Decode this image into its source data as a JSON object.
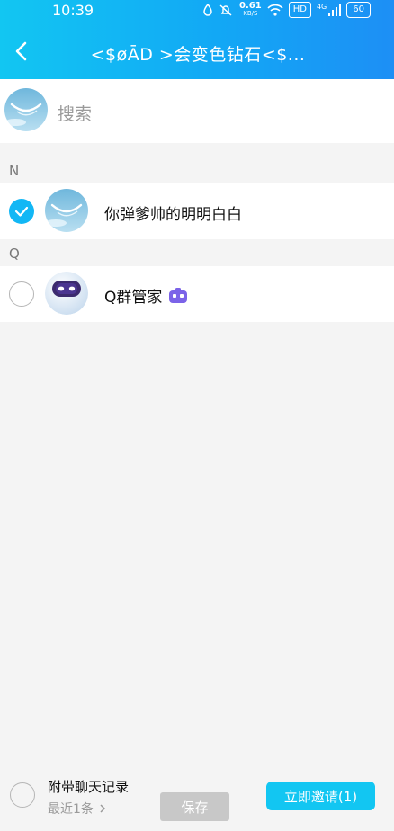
{
  "status_bar": {
    "time": "10:39",
    "speed_value": "0.61",
    "speed_unit": "KB/S",
    "hd_badge": "HD",
    "network": "4G",
    "battery": "60"
  },
  "header": {
    "title": "<$øĀD >会变色钻石<$...",
    "back_icon": "chevron-left-icon"
  },
  "search": {
    "placeholder": "搜索"
  },
  "sections": [
    {
      "letter": "N",
      "contacts": [
        {
          "name": "你弹爹帅的明明白白",
          "selected": true
        }
      ]
    },
    {
      "letter": "Q",
      "contacts": [
        {
          "name": "Q群管家",
          "selected": false,
          "badge_icon": "robot-badge-icon"
        }
      ]
    }
  ],
  "bottom": {
    "attach_label": "附带聊天记录",
    "attach_sub": "最近1条",
    "save_label": "保存",
    "invite_label": "立即邀请(1)"
  },
  "colors": {
    "header_gradient_start": "#12c6f2",
    "header_gradient_end": "#1d8ff5",
    "accent": "#12b7f5",
    "disabled_button": "#c8c8c8"
  }
}
